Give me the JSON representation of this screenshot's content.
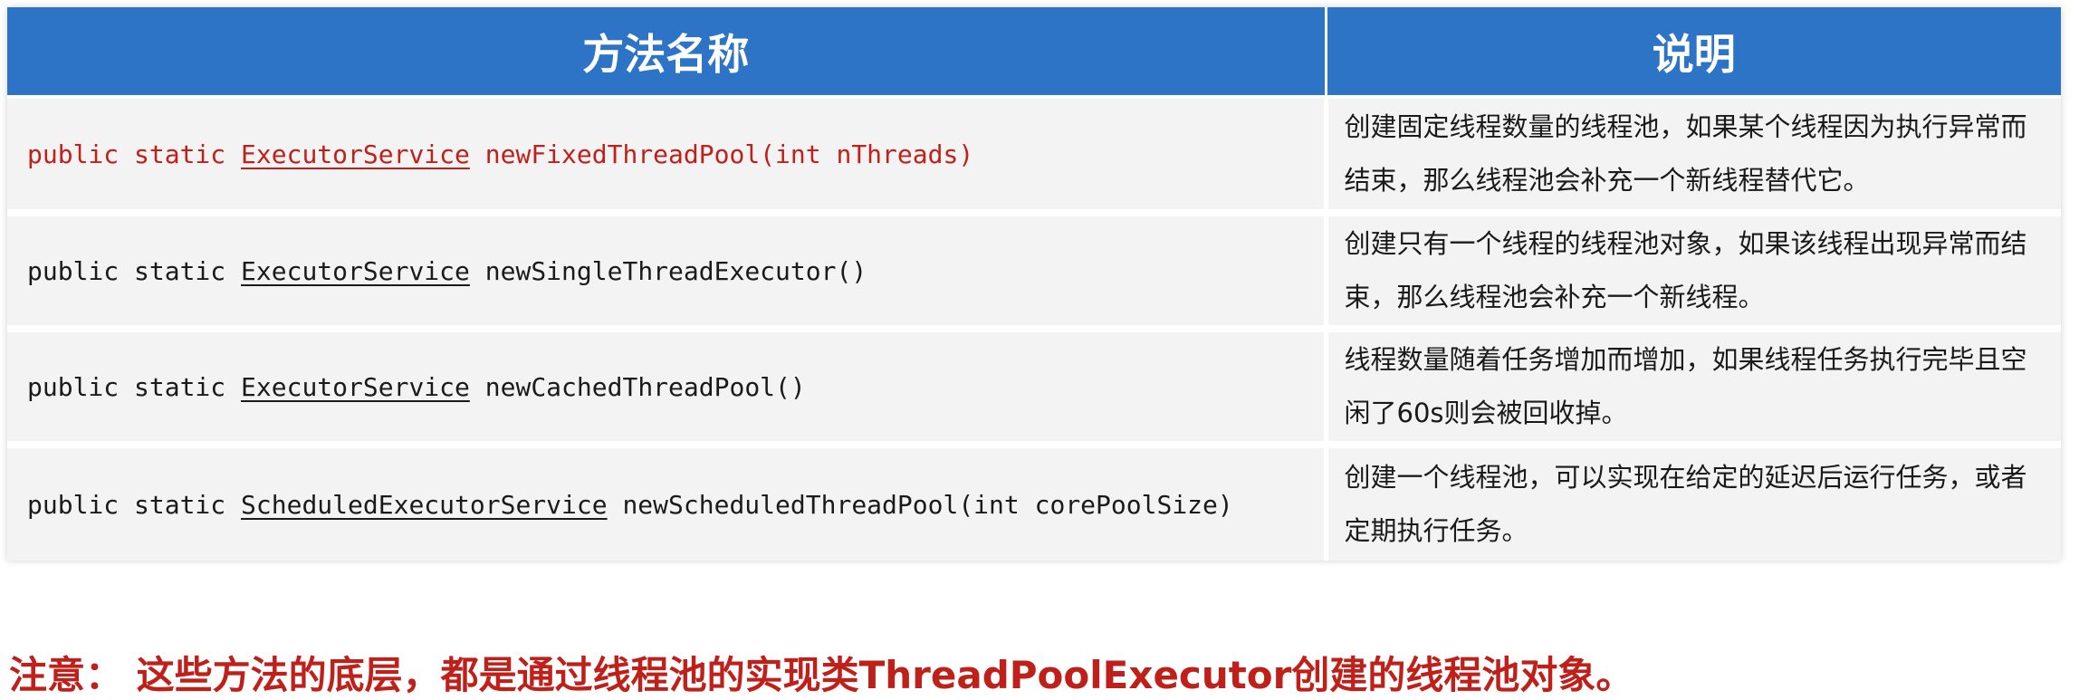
{
  "table": {
    "headers": [
      "方法名称",
      "说明"
    ],
    "rows": [
      {
        "prefix": "public static ",
        "return_type": "ExecutorService",
        "method": " newFixedThreadPool(int nThreads)",
        "description": "创建固定线程数量的线程池，如果某个线程因为执行异常而结束，那么线程池会补充一个新线程替代它。"
      },
      {
        "prefix": "public static ",
        "return_type": "ExecutorService",
        "method": " newSingleThreadExecutor()",
        "description": "创建只有一个线程的线程池对象，如果该线程出现异常而结束，那么线程池会补充一个新线程。"
      },
      {
        "prefix": "public static ",
        "return_type": "ExecutorService",
        "method": " newCachedThreadPool()",
        "description": "线程数量随着任务增加而增加，如果线程任务执行完毕且空闲了60s则会被回收掉。"
      },
      {
        "prefix": "public static ",
        "return_type": "ScheduledExecutorService",
        "method": " newScheduledThreadPool(int corePoolSize)",
        "description": "创建一个线程池，可以实现在给定的延迟后运行任务，或者定期执行任务。"
      }
    ]
  },
  "note": "注意： 这些方法的底层，都是通过线程池的实现类ThreadPoolExecutor创建的线程池对象。",
  "colors": {
    "header_bg": "#2d73c6",
    "highlight_text": "#c0201a",
    "row_bg": "#f3f3f3"
  }
}
